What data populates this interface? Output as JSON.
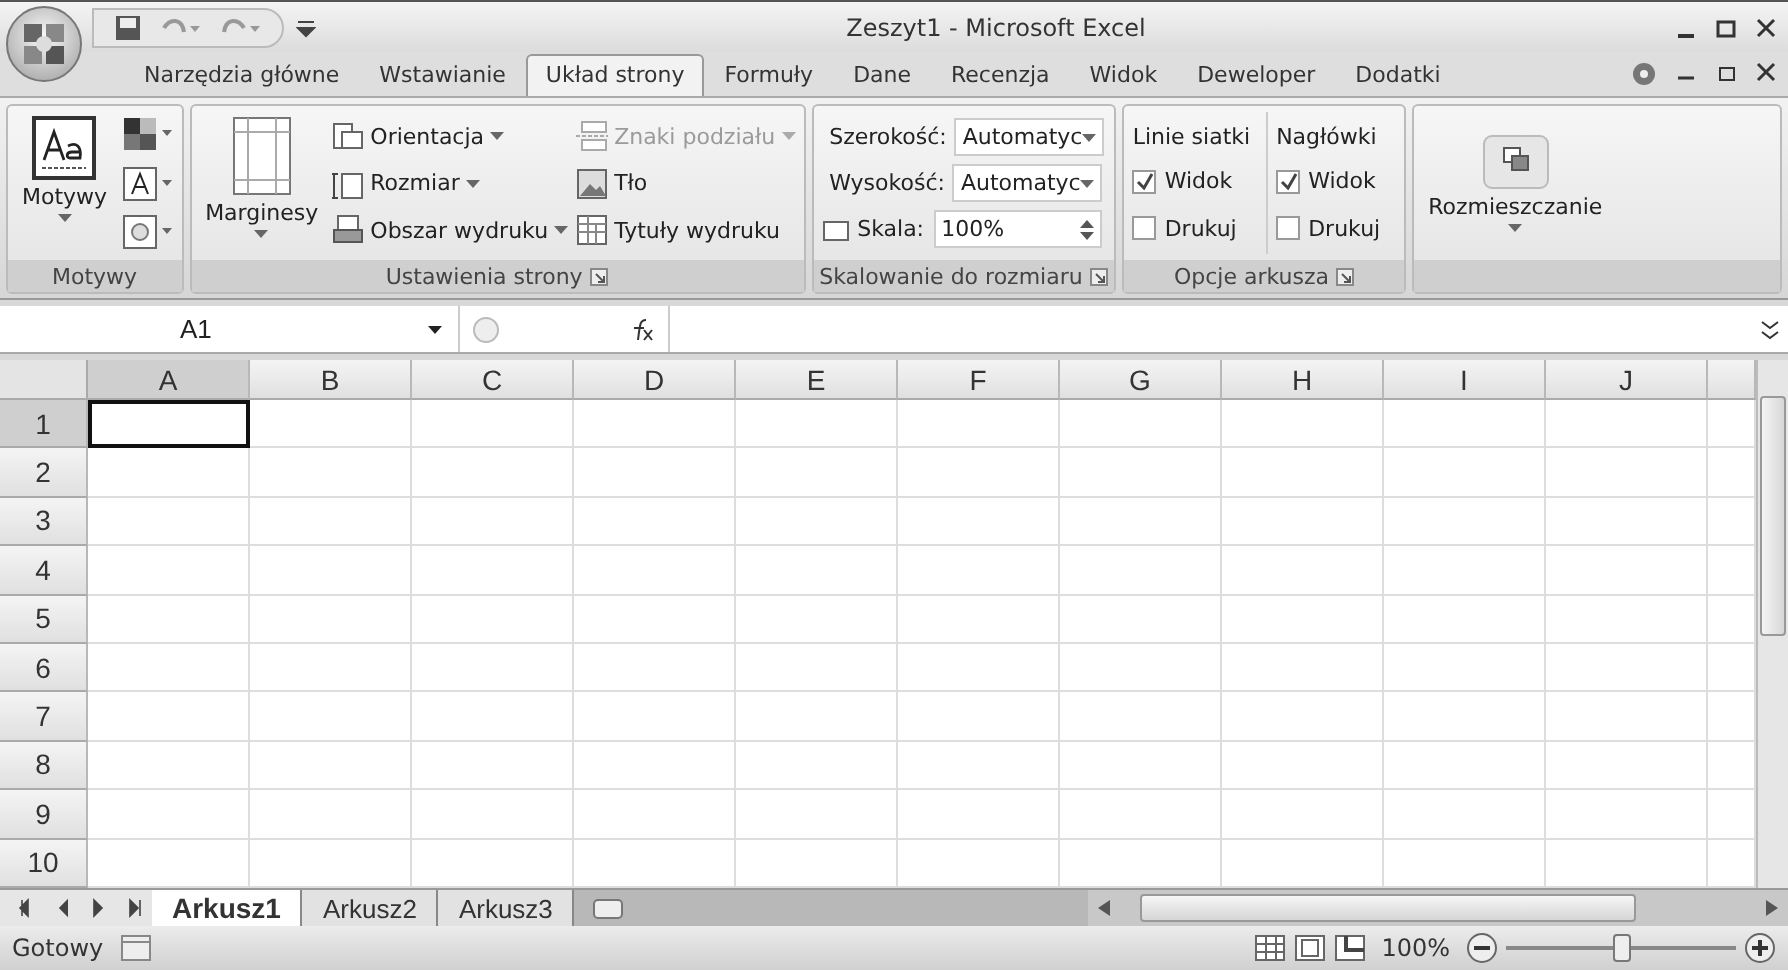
{
  "window": {
    "title": "Zeszyt1 - Microsoft Excel"
  },
  "tabs": [
    {
      "label": "Narzędzia główne",
      "selected": false
    },
    {
      "label": "Wstawianie",
      "selected": false
    },
    {
      "label": "Układ strony",
      "selected": true
    },
    {
      "label": "Formuły",
      "selected": false
    },
    {
      "label": "Dane",
      "selected": false
    },
    {
      "label": "Recenzja",
      "selected": false
    },
    {
      "label": "Widok",
      "selected": false
    },
    {
      "label": "Deweloper",
      "selected": false
    },
    {
      "label": "Dodatki",
      "selected": false
    }
  ],
  "ribbon": {
    "groups": [
      {
        "kind": "themes",
        "label": "Motywy",
        "big": "Motywy"
      },
      {
        "kind": "page",
        "label": "Ustawienia strony",
        "big": "Marginesy",
        "items": [
          {
            "label": "Orientacja",
            "kind": "orientation",
            "dropdown": true,
            "disabled": false
          },
          {
            "label": "Rozmiar",
            "kind": "size",
            "dropdown": true,
            "disabled": false
          },
          {
            "label": "Obszar wydruku",
            "kind": "print",
            "dropdown": true,
            "disabled": false
          },
          {
            "label": "Znaki podziału",
            "kind": "breaks",
            "dropdown": true,
            "disabled": true
          },
          {
            "label": "Tło",
            "kind": "background",
            "dropdown": false,
            "disabled": false
          },
          {
            "label": "Tytuły wydruku",
            "kind": "titles",
            "dropdown": false,
            "disabled": false
          }
        ]
      },
      {
        "kind": "scale",
        "label": "Skalowanie do rozmiaru",
        "fields": [
          {
            "label": "Szerokość:",
            "value": "Automatyc",
            "kind": "dropdown"
          },
          {
            "label": "Wysokość:",
            "value": "Automatyc",
            "kind": "dropdown"
          },
          {
            "label": "Skala:",
            "value": "100%",
            "kind": "spinner"
          }
        ]
      },
      {
        "kind": "sheet",
        "label": "Opcje arkusza",
        "columns": [
          {
            "title": "Linie siatki",
            "options": [
              {
                "label": "Widok",
                "checked": true
              },
              {
                "label": "Drukuj",
                "checked": false
              }
            ]
          },
          {
            "title": "Nagłówki",
            "options": [
              {
                "label": "Widok",
                "checked": true
              },
              {
                "label": "Drukuj",
                "checked": false
              }
            ]
          }
        ]
      },
      {
        "kind": "arrange",
        "big": "Rozmieszczanie"
      }
    ]
  },
  "formula_bar": {
    "name_box": "A1"
  },
  "sheet": {
    "columns": [
      {
        "label": "A",
        "selected": true
      },
      {
        "label": "B",
        "selected": false
      },
      {
        "label": "C",
        "selected": false
      },
      {
        "label": "D",
        "selected": false
      },
      {
        "label": "E",
        "selected": false
      },
      {
        "label": "F",
        "selected": false
      },
      {
        "label": "G",
        "selected": false
      },
      {
        "label": "H",
        "selected": false
      },
      {
        "label": "I",
        "selected": false
      },
      {
        "label": "J",
        "selected": false
      }
    ],
    "rows": [
      {
        "label": "1",
        "selected": true
      },
      {
        "label": "2",
        "selected": false
      },
      {
        "label": "3",
        "selected": false
      },
      {
        "label": "4",
        "selected": false
      },
      {
        "label": "5",
        "selected": false
      },
      {
        "label": "6",
        "selected": false
      },
      {
        "label": "7",
        "selected": false
      },
      {
        "label": "8",
        "selected": false
      },
      {
        "label": "9",
        "selected": false
      },
      {
        "label": "10",
        "selected": false
      }
    ]
  },
  "sheet_tabs": [
    {
      "label": "Arkusz1",
      "selected": true
    },
    {
      "label": "Arkusz2",
      "selected": false
    },
    {
      "label": "Arkusz3",
      "selected": false
    }
  ],
  "status_bar": {
    "status": "Gotowy",
    "zoom": "100%",
    "zoom_slider": {
      "level": 0.5
    }
  }
}
